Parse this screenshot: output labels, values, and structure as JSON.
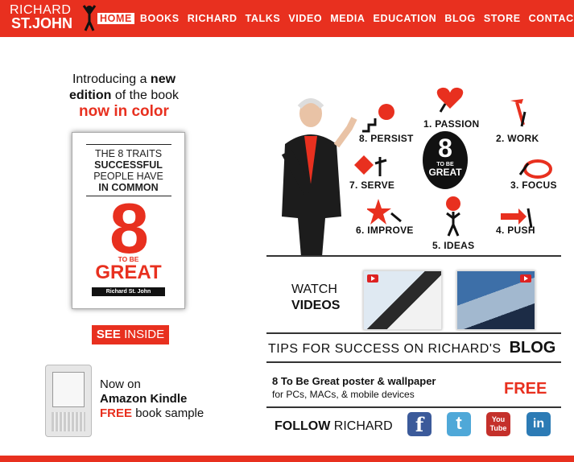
{
  "brand": {
    "line1": "RICHARD",
    "line2": "ST.JOHN"
  },
  "nav": {
    "items": [
      "HOME",
      "BOOKS",
      "RICHARD",
      "TALKS",
      "VIDEO",
      "MEDIA",
      "EDUCATION",
      "BLOG",
      "STORE",
      "CONTACT"
    ],
    "active": "HOME"
  },
  "intro": {
    "line1_a": "Introducing a",
    "line1_b": "new",
    "line2_a": "edition",
    "line2_b": "of the book",
    "line3": "now in color"
  },
  "book": {
    "title_line1": "THE 8 TRAITS",
    "title_line2": "SUCCESSFUL",
    "title_line3": "PEOPLE HAVE",
    "title_line4": "IN COMMON",
    "number": "8",
    "to_be": "TO BE",
    "great": "GREAT",
    "author": "Richard St. John"
  },
  "see_inside": {
    "bold": "SEE",
    "rest": "INSIDE"
  },
  "kindle": {
    "line1": "Now on",
    "line2": "Amazon Kindle",
    "line3_red": "FREE",
    "line3_rest": "book sample"
  },
  "traits_graphic": {
    "center_number": "8",
    "center_to_be": "TO BE",
    "center_great": "GREAT",
    "traits": [
      "1. PASSION",
      "2. WORK",
      "3. FOCUS",
      "4. PUSH",
      "5. IDEAS",
      "6. IMPROVE",
      "7. SERVE",
      "8. PERSIST"
    ]
  },
  "videos": {
    "watch": "WATCH",
    "videos": "VIDEOS"
  },
  "tips": {
    "text": "TIPS FOR SUCCESS ON RICHARD'S",
    "blog": "BLOG"
  },
  "poster": {
    "title": "8 To Be Great poster & wallpaper",
    "sub": "for PCs, MACs, & mobile devices",
    "free": "FREE"
  },
  "follow": {
    "bold": "FOLLOW",
    "rest": "RICHARD"
  },
  "social": [
    {
      "icon": "facebook-icon",
      "label": "f",
      "color": "#3b5a9a"
    },
    {
      "icon": "twitter-icon",
      "label": "t",
      "color": "#4fa8d8"
    },
    {
      "icon": "youtube-icon",
      "label": "You Tube",
      "color": "#c4302b"
    },
    {
      "icon": "linkedin-icon",
      "label": "in",
      "color": "#2c7bb5"
    }
  ],
  "colors": {
    "brand_red": "#e8301f"
  }
}
